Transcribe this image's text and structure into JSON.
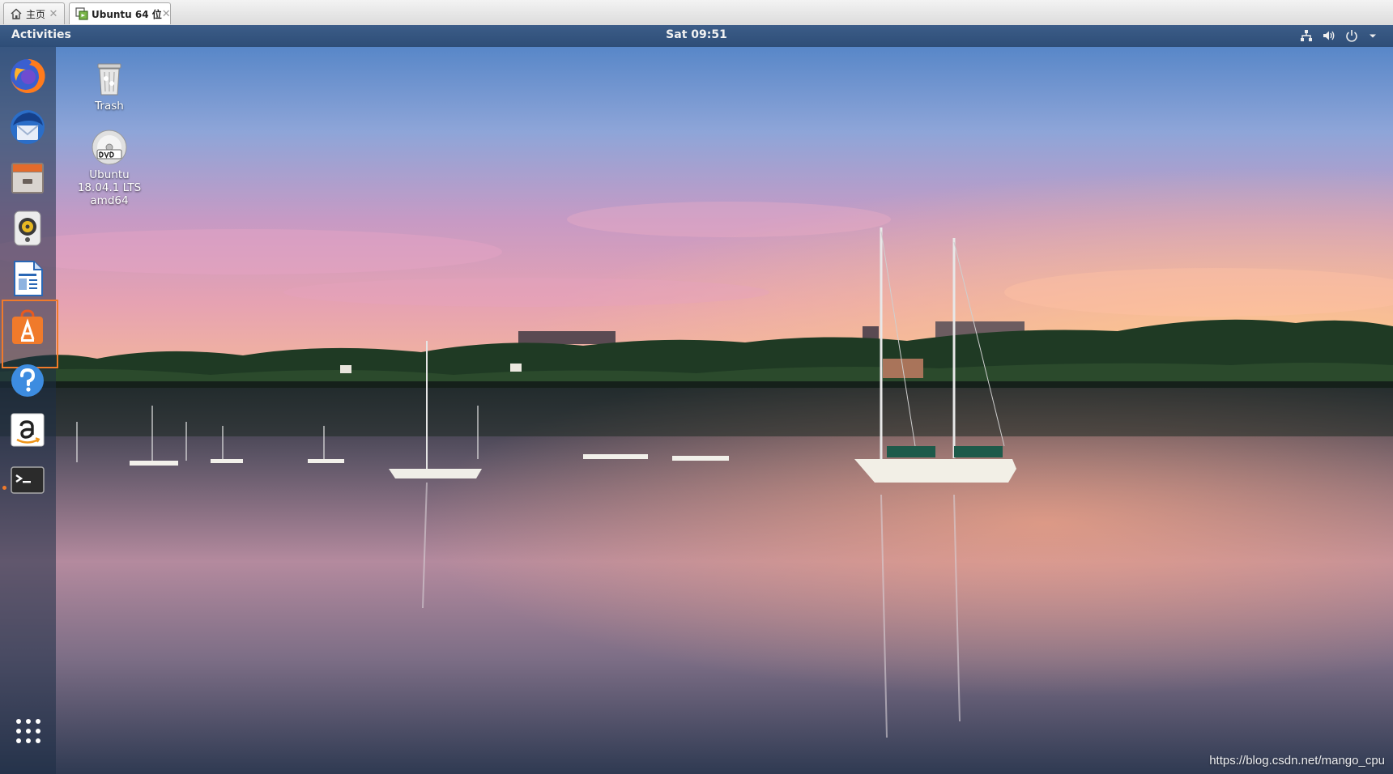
{
  "host_tabs": [
    {
      "label": "主页",
      "icon": "home-icon",
      "close": "✕"
    },
    {
      "label": "Ubuntu 64 位",
      "icon": "vm-icon",
      "close": "✕"
    }
  ],
  "topbar": {
    "activities": "Activities",
    "clock": "Sat 09:51",
    "tray": [
      "network-icon",
      "volume-icon",
      "power-icon",
      "chevron-down-icon"
    ]
  },
  "dock": {
    "items": [
      {
        "name": "firefox",
        "icon": "firefox-icon"
      },
      {
        "name": "thunderbird",
        "icon": "thunderbird-icon"
      },
      {
        "name": "files",
        "icon": "files-icon"
      },
      {
        "name": "rhythmbox",
        "icon": "rhythmbox-icon"
      },
      {
        "name": "libreoffice-writer",
        "icon": "writer-icon"
      },
      {
        "name": "ubuntu-software",
        "icon": "software-center-icon",
        "highlighted": true
      },
      {
        "name": "help",
        "icon": "help-icon"
      },
      {
        "name": "amazon",
        "icon": "amazon-icon"
      },
      {
        "name": "terminal",
        "icon": "terminal-icon",
        "running": true
      }
    ],
    "show_apps_icon": "app-grid-icon",
    "highlight_color": "#f07a2b"
  },
  "desktop": {
    "icons": [
      {
        "label": "Trash",
        "icon": "trash-icon"
      },
      {
        "label": "Ubuntu 18.04.1 LTS amd64",
        "icon": "dvd-icon"
      }
    ]
  },
  "watermark": "https://blog.csdn.net/mango_cpu",
  "colors": {
    "topbar": "#2e4d77",
    "accent": "#f07a2b"
  }
}
